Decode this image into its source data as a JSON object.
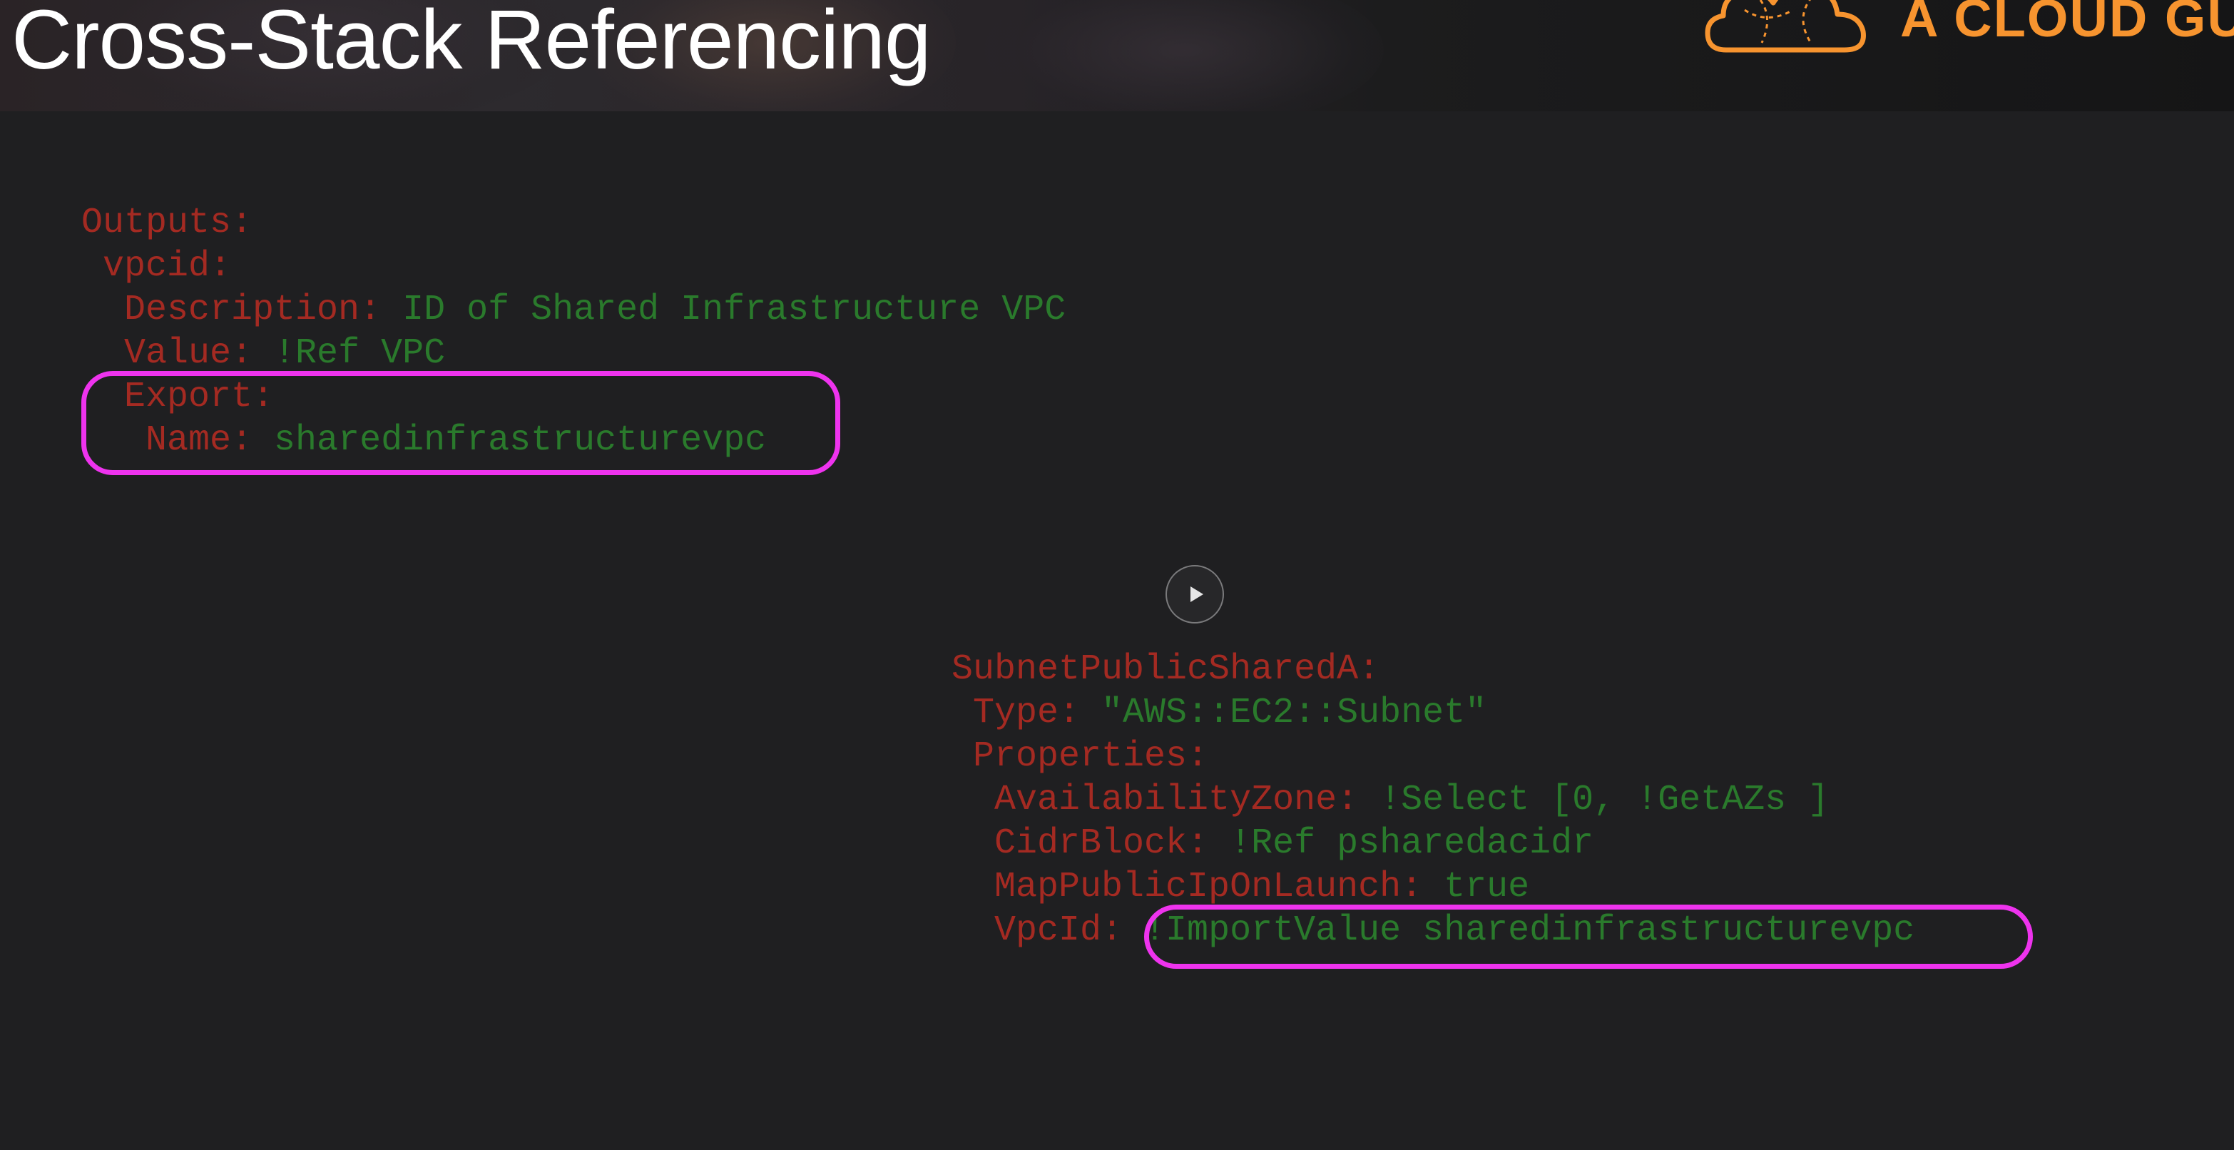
{
  "slide": {
    "title": "Cross-Stack Referencing",
    "brand_text": "A CLOUD GU"
  },
  "colors": {
    "background": "#1f1f21",
    "key": "#a42a22",
    "value": "#2a7a2c",
    "highlight": "#ee33ee",
    "brand": "#f7942f"
  },
  "icons": {
    "brand_logo": "cloud-logo-icon",
    "play": "play-icon"
  },
  "outputs_block": {
    "lines": [
      {
        "key": "Outputs:",
        "value": ""
      },
      {
        "key": " vpcid:",
        "value": ""
      },
      {
        "key": "  Description:",
        "value": " ID of Shared Infrastructure VPC"
      },
      {
        "key": "  Value:",
        "value": " !Ref VPC"
      },
      {
        "key": "  Export:",
        "value": ""
      },
      {
        "key": "   Name:",
        "value": " sharedinfrastructurevpc"
      }
    ]
  },
  "subnet_block": {
    "lines": [
      {
        "key": "SubnetPublicSharedA:",
        "value": ""
      },
      {
        "key": " Type:",
        "value": " \"AWS::EC2::Subnet\""
      },
      {
        "key": " Properties:",
        "value": ""
      },
      {
        "key": "  AvailabilityZone:",
        "value": " !Select [0, !GetAZs ]"
      },
      {
        "key": "  CidrBlock:",
        "value": " !Ref psharedacidr"
      },
      {
        "key": "  MapPublicIpOnLaunch:",
        "value": " true"
      },
      {
        "key": "  VpcId:",
        "value": " !ImportValue sharedinfrastructurevpc"
      }
    ]
  }
}
